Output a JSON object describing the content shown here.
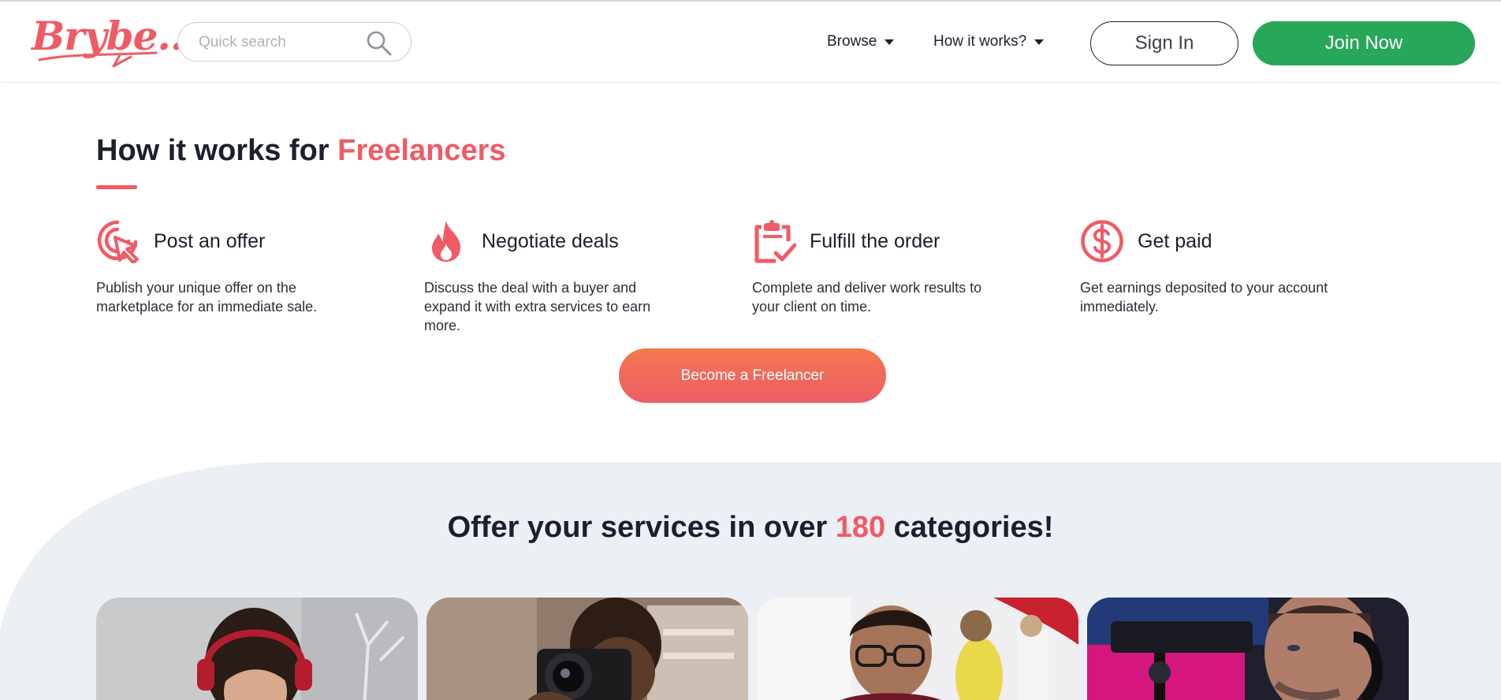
{
  "brand": {
    "logo_text": "Brybe..."
  },
  "search": {
    "placeholder": "Quick search"
  },
  "nav": {
    "browse": "Browse",
    "how_it_works": "How it works?"
  },
  "auth": {
    "sign_in": "Sign In",
    "join_now": "Join Now"
  },
  "how_it_works": {
    "title_prefix": "How it works for ",
    "title_accent": "Freelancers",
    "steps": [
      {
        "icon": "target-cursor-icon",
        "title": "Post an offer",
        "description": "Publish your unique offer on the marketplace for an immediate sale."
      },
      {
        "icon": "flame-icon",
        "title": "Negotiate deals",
        "description": "Discuss the deal with a buyer and expand it with extra services to earn more."
      },
      {
        "icon": "clipboard-check-icon",
        "title": "Fulfill the order",
        "description": "Complete and deliver work results to your client on time."
      },
      {
        "icon": "dollar-circle-icon",
        "title": "Get paid",
        "description": "Get earnings deposited to your account immediately."
      }
    ],
    "cta": "Become a Freelancer"
  },
  "categories": {
    "title_prefix": "Offer your services in over ",
    "title_accent": "180",
    "title_suffix": " categories!",
    "cards": [
      {
        "image": "woman-with-headphones"
      },
      {
        "image": "man-with-camera"
      },
      {
        "image": "man-with-glasses"
      },
      {
        "image": "man-with-headset"
      }
    ]
  },
  "colors": {
    "accent": "#ef5b66",
    "join_green": "#27a75a",
    "cta_gradient_top": "#f2784f",
    "cta_gradient_bottom": "#ee5d66",
    "band_grey": "#eceff4"
  }
}
